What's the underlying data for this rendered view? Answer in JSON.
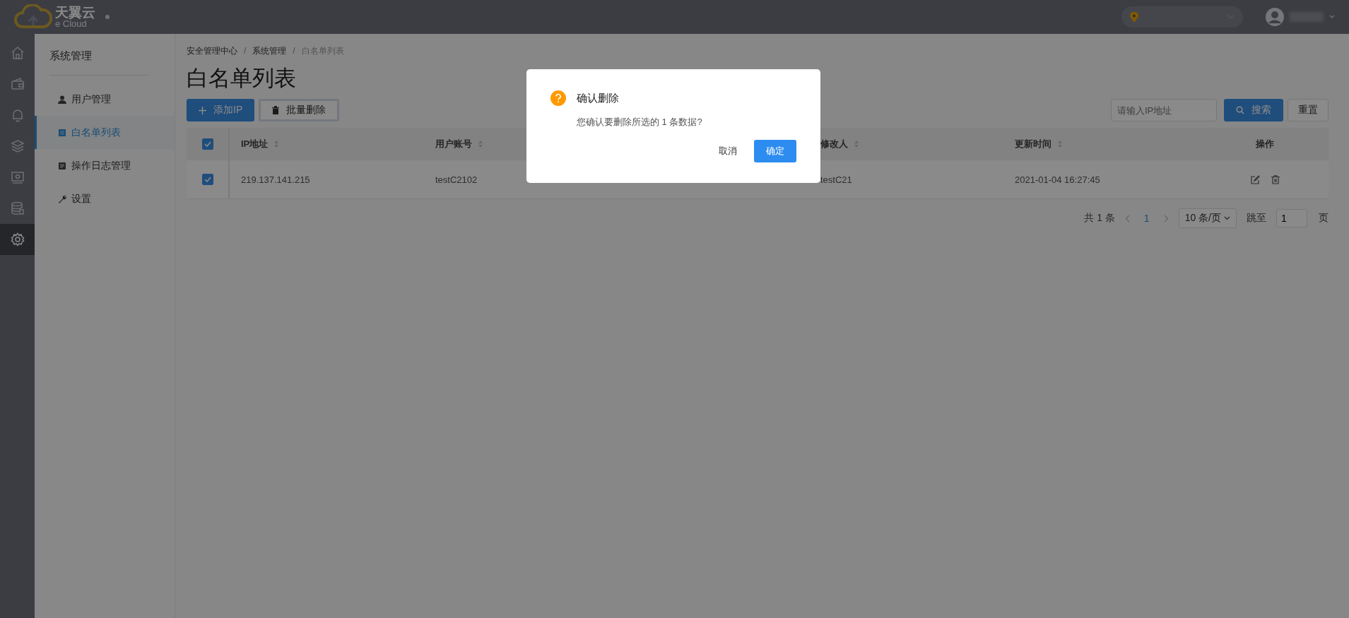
{
  "topbar": {
    "logo_cn": "天翼云",
    "logo_en": "e Cloud"
  },
  "rail": [
    {
      "kind": "home",
      "selected": false
    },
    {
      "kind": "wallet",
      "selected": false
    },
    {
      "kind": "bell",
      "selected": false
    },
    {
      "kind": "layers",
      "selected": false
    },
    {
      "kind": "monitor",
      "selected": false
    },
    {
      "kind": "database",
      "selected": false
    },
    {
      "kind": "gear",
      "selected": true
    }
  ],
  "sidebar": {
    "title": "系统管理",
    "items": [
      {
        "label": "用户管理",
        "kind": "user",
        "selected": false
      },
      {
        "label": "白名单列表",
        "kind": "list",
        "selected": true
      },
      {
        "label": "操作日志管理",
        "kind": "log",
        "selected": false
      },
      {
        "label": "设置",
        "kind": "wrench",
        "selected": false
      }
    ]
  },
  "breadcrumb": {
    "items": [
      "安全管理中心",
      "系统管理",
      "白名单列表"
    ],
    "separator": "/"
  },
  "page_title": "白名单列表",
  "toolbar": {
    "add_button": "添加IP",
    "batch_delete_button": "批量删除",
    "search": {
      "placeholder": "请输入IP地址"
    },
    "search_button": "搜索",
    "reset_button": "重置"
  },
  "table": {
    "select_all_checked": true,
    "columns": [
      {
        "label": "IP地址",
        "sortable": true
      },
      {
        "label": "用户账号",
        "sortable": true
      },
      {},
      {
        "label": "修改人",
        "sortable": true
      },
      {
        "label": "更新时间",
        "sortable": true
      },
      {
        "label": "操作",
        "sortable": false
      }
    ],
    "rows": [
      {
        "checked": true,
        "ip": "219.137.141.215",
        "account": "testC2102",
        "modifier": "testC21",
        "updated_at": "2021-01-04 16:27:45"
      }
    ]
  },
  "pagination": {
    "total": "共 1 条",
    "pages": [
      {
        "label": "1",
        "selected": true
      }
    ],
    "page_size": "10 条/页",
    "jump_label": "跳至",
    "jump_value": "1",
    "page_suffix": "页"
  },
  "dialog": {
    "title": "确认删除",
    "message": "您确认要删除所选的 1 条数据?",
    "cancel_button": "取消",
    "confirm_button": "确定"
  }
}
